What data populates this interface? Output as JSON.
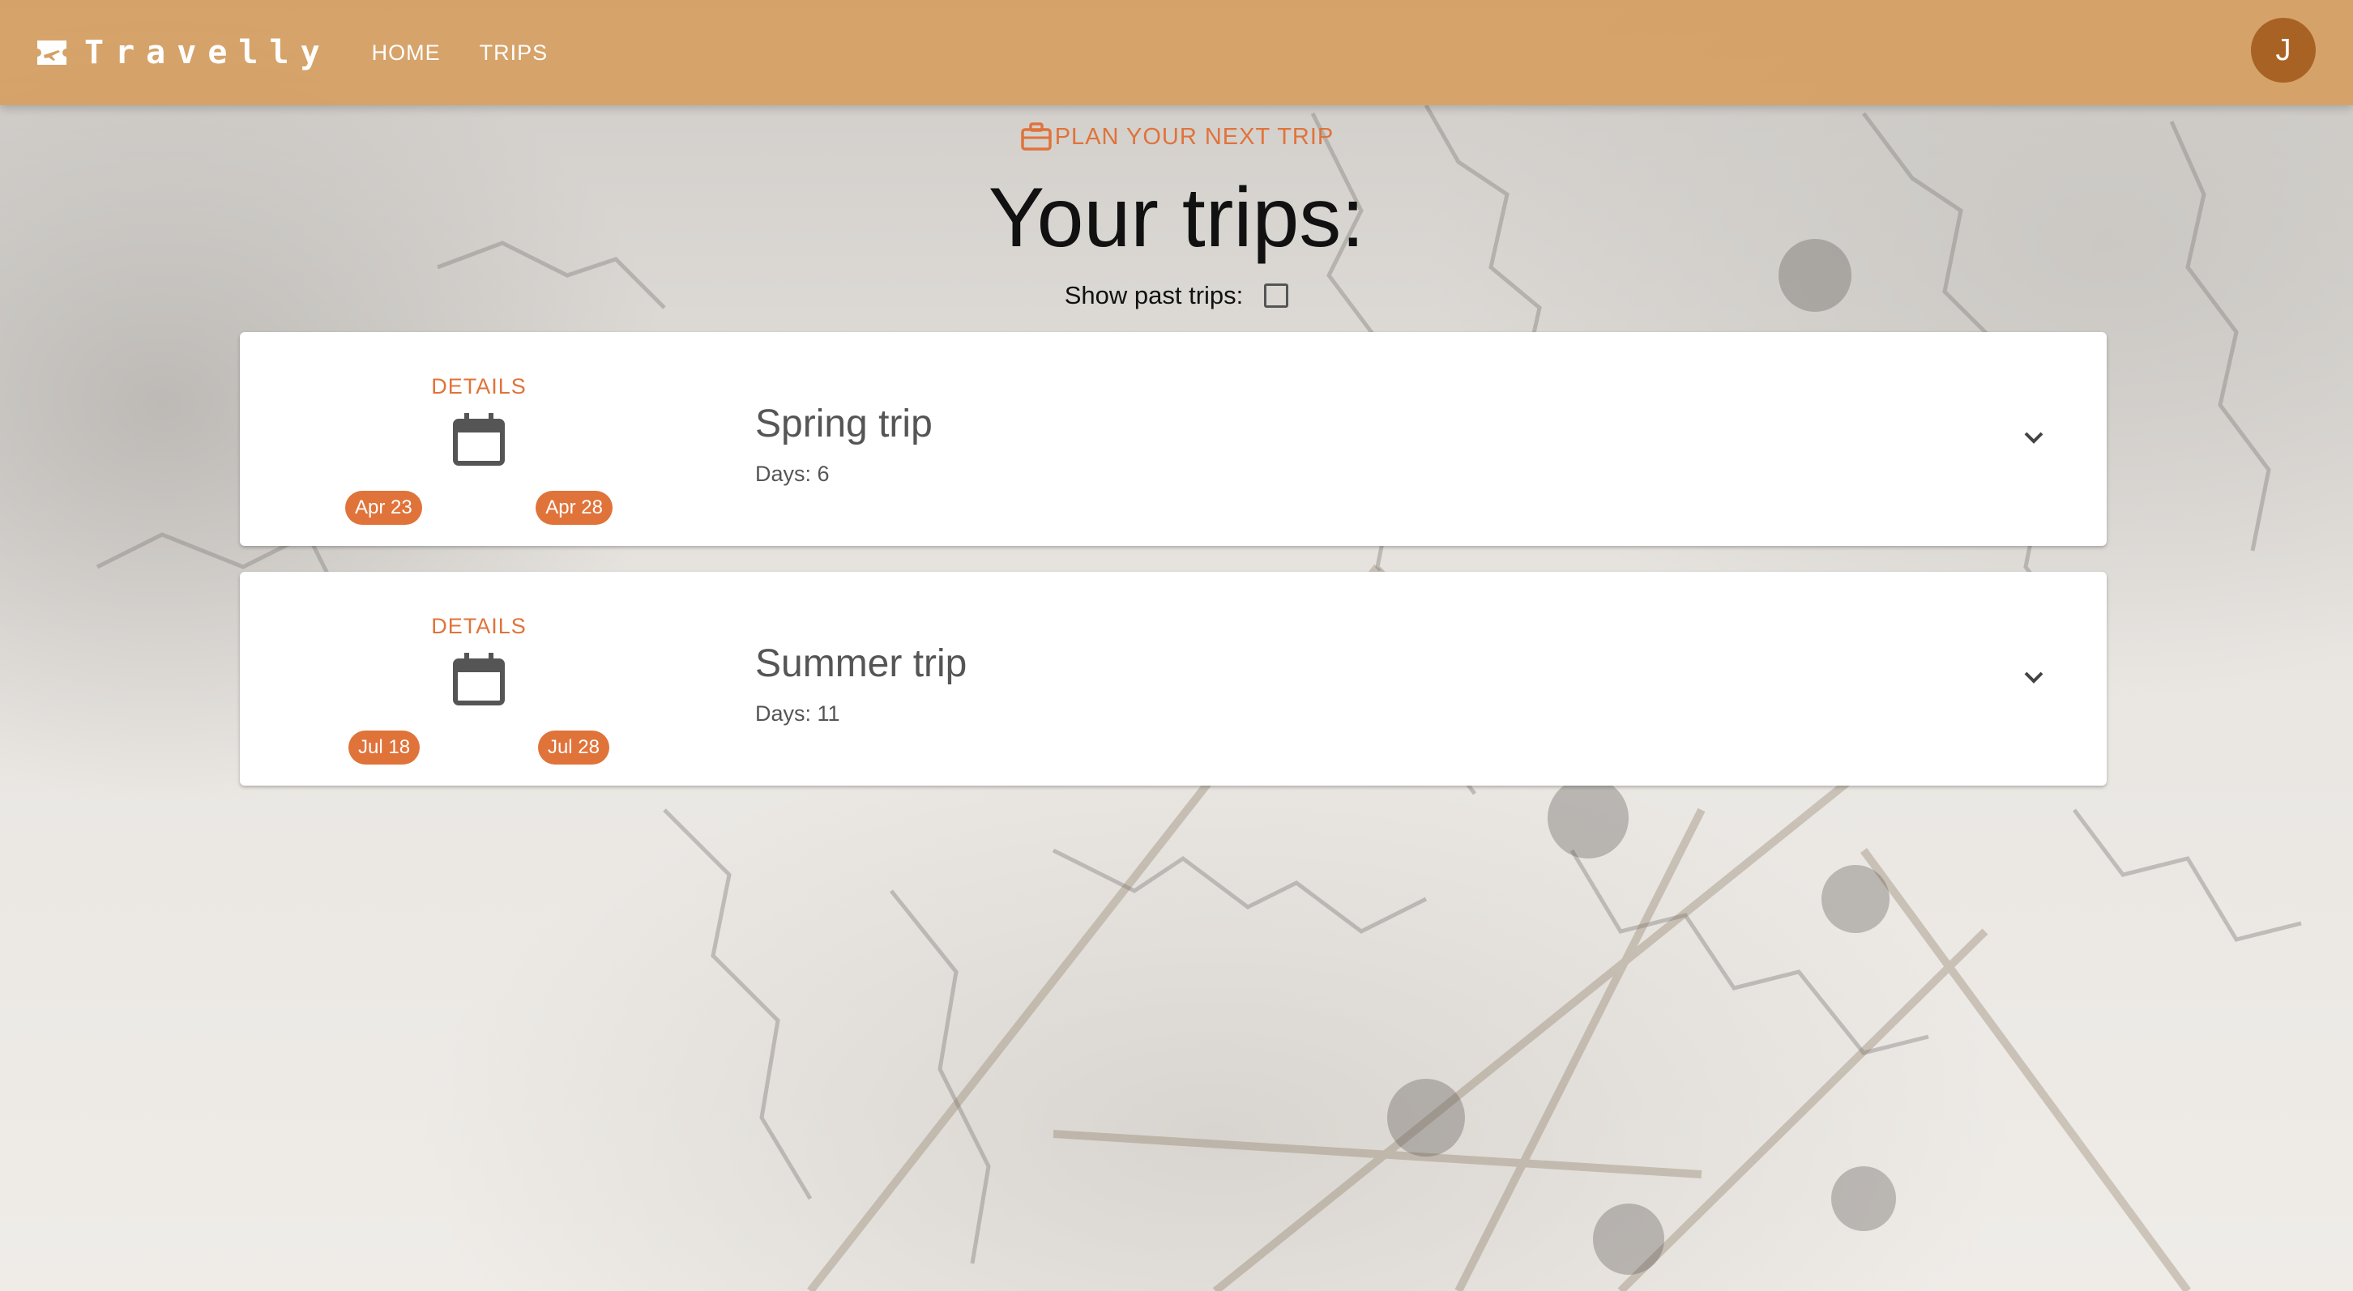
{
  "app": {
    "name": "Travelly",
    "nav": [
      {
        "label": "HOME"
      },
      {
        "label": "TRIPS"
      }
    ],
    "avatar_initial": "J",
    "logo_icon": "airplane-ticket-icon"
  },
  "colors": {
    "appbar": "#d6a064",
    "accent": "#e0733a",
    "avatar": "#a86324"
  },
  "main": {
    "plan_label": "PLAN YOUR NEXT TRIP",
    "plan_icon": "luggage-icon",
    "title": "Your trips:",
    "show_past_label": "Show past trips:",
    "show_past_checked": false
  },
  "trips": [
    {
      "details_label": "DETAILS",
      "start": "Apr 23",
      "end": "Apr 28",
      "name": "Spring trip",
      "days": "Days: 6",
      "calendar_icon": "calendar-icon",
      "expand_icon": "chevron-down-icon"
    },
    {
      "details_label": "DETAILS",
      "start": "Jul 18",
      "end": "Jul 28",
      "name": "Summer trip",
      "days": "Days: 11",
      "calendar_icon": "calendar-icon",
      "expand_icon": "chevron-down-icon"
    }
  ]
}
